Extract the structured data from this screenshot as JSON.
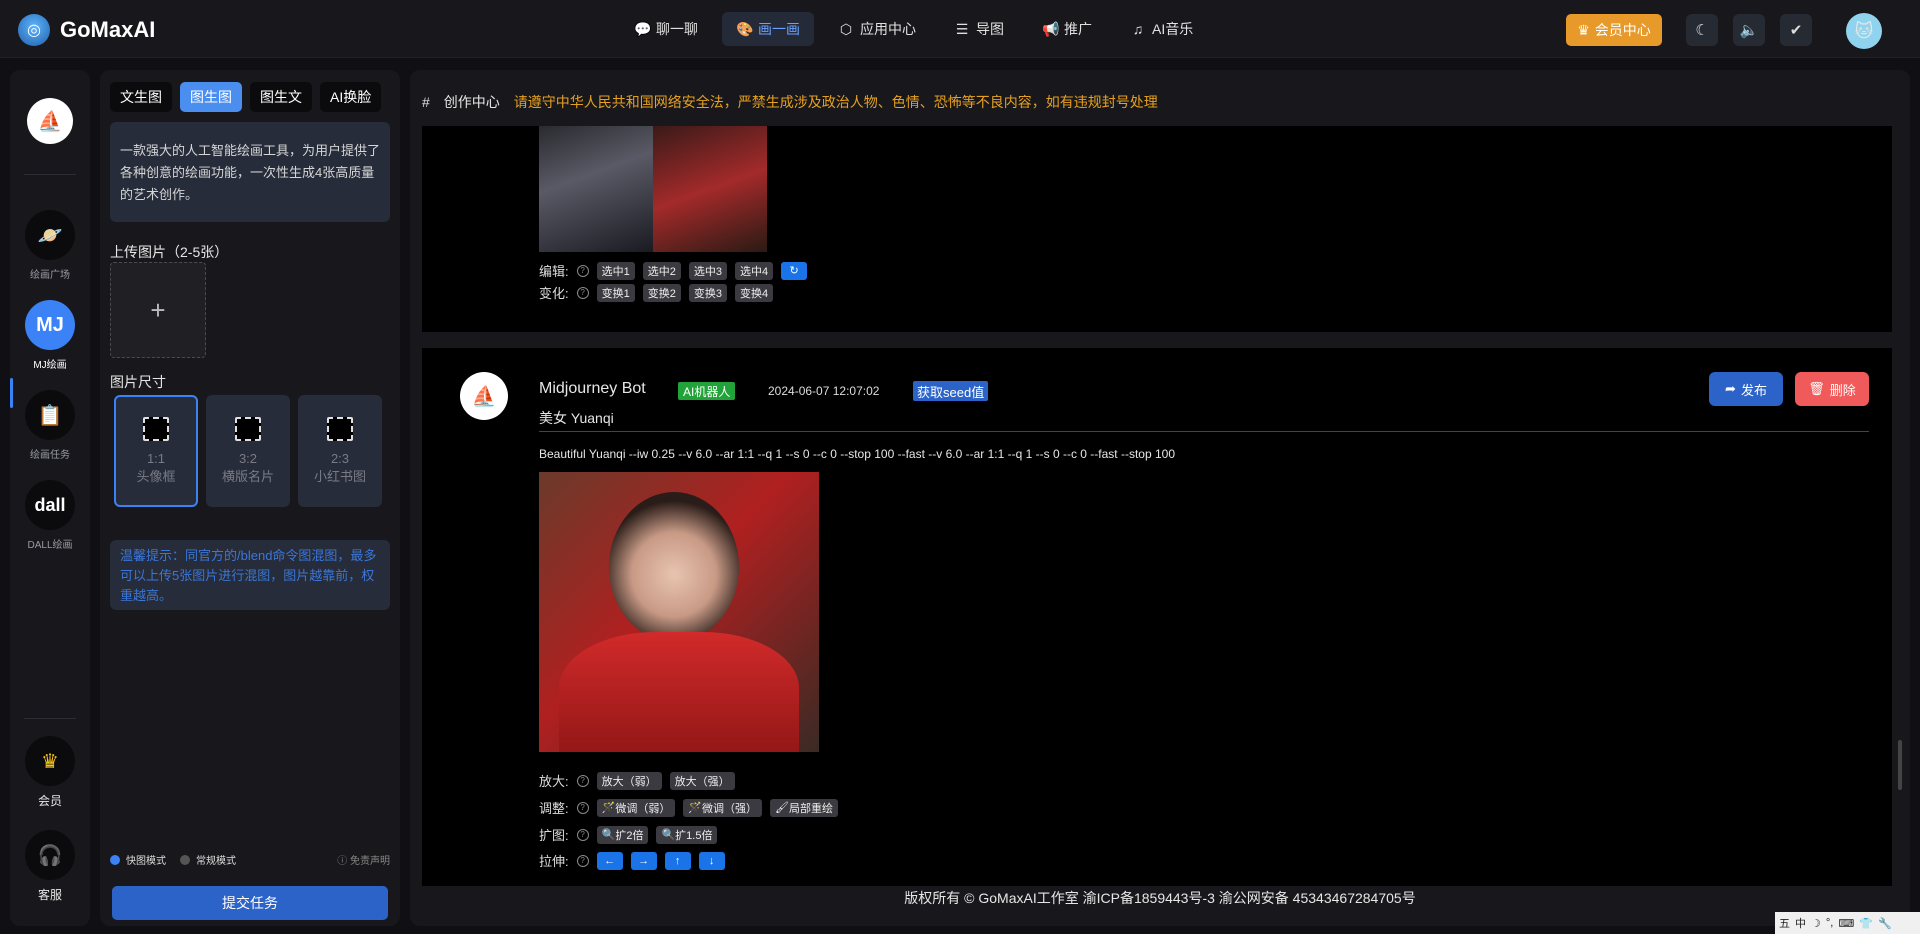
{
  "header": {
    "brand": "GoMaxAI",
    "nav": [
      {
        "label": "聊一聊",
        "icon": "chat-icon"
      },
      {
        "label": "画一画",
        "icon": "palette-icon",
        "active": true
      },
      {
        "label": "应用中心",
        "icon": "cube-icon"
      },
      {
        "label": "导图",
        "icon": "mindmap-icon"
      },
      {
        "label": "推广",
        "icon": "megaphone-icon"
      },
      {
        "label": "AI音乐",
        "icon": "music-icon"
      }
    ],
    "vip_label": "会员中心"
  },
  "rail": {
    "items": [
      {
        "label": "绘画广场",
        "icon": "planet-icon"
      },
      {
        "label": "MJ绘画",
        "badge": "MJ",
        "active": true
      },
      {
        "label": "绘画任务",
        "icon": "clipboard-icon"
      },
      {
        "label": "DALL绘画",
        "badge": "dall"
      }
    ],
    "bottom": [
      {
        "label": "会员",
        "icon": "crown-icon"
      },
      {
        "label": "客服",
        "icon": "support-icon"
      }
    ]
  },
  "panel": {
    "tabs": [
      "文生图",
      "图生图",
      "图生文",
      "AI换脸"
    ],
    "active_tab": "图生图",
    "description": "一款强大的人工智能绘画工具，为用户提供了各种创意的绘画功能，一次性生成4张高质量的艺术创作。",
    "upload_title": "上传图片（2-5张）",
    "upload_plus": "+",
    "size_title": "图片尺寸",
    "sizes": [
      {
        "ratio": "1:1",
        "name": "头像框",
        "active": true
      },
      {
        "ratio": "3:2",
        "name": "横版名片"
      },
      {
        "ratio": "2:3",
        "name": "小红书图"
      }
    ],
    "tip": "温馨提示：同官方的/blend命令图混图，最多可以上传5张图片进行混图，图片越靠前，权重越高。",
    "modes": [
      "快图模式",
      "常规模式"
    ],
    "disclaimer": "免责声明",
    "submit": "提交任务"
  },
  "main": {
    "hash": "#",
    "title": "创作中心",
    "warning": "请遵守中华人民共和国网络安全法，严禁生成涉及政治人物、色情、恐怖等不良内容，如有违规封号处理",
    "card1": {
      "edit_label": "编辑:",
      "edit_chips": [
        "选中1",
        "选中2",
        "选中3",
        "选中4"
      ],
      "vary_label": "变化:",
      "vary_chips": [
        "变换1",
        "变换2",
        "变换3",
        "变换4"
      ]
    },
    "card2": {
      "bot_name": "Midjourney Bot",
      "ai_tag": "AI机器人",
      "time": "2024-06-07 12:07:02",
      "seed": "获取seed值",
      "publish": "发布",
      "delete": "删除",
      "subject": "美女 Yuanqi",
      "prompt": "Beautiful Yuanqi --iw 0.25 --v 6.0 --ar 1:1 --q 1 --s 0 --c 0 --stop 100 --fast --v 6.0 --ar 1:1 --q 1 --s 0 --c 0 --fast --stop 100",
      "rows": [
        {
          "label": "放大:",
          "chips": [
            "放大（弱）",
            "放大（强）"
          ]
        },
        {
          "label": "调整:",
          "chips": [
            "微调（弱）",
            "微调（强）",
            "局部重绘"
          ]
        },
        {
          "label": "扩图:",
          "chips": [
            "扩2倍",
            "扩1.5倍"
          ]
        },
        {
          "label": "拉伸:",
          "chips": [
            "←",
            "→",
            "↑",
            "↓"
          ]
        }
      ]
    },
    "footer": "版权所有 © GoMaxAI工作室 渝ICP备1859443号-3 渝公网安备 45343467284705号"
  },
  "tray": [
    "五",
    "中",
    "☽",
    "°,",
    "⌨",
    "👕",
    "🔧"
  ]
}
